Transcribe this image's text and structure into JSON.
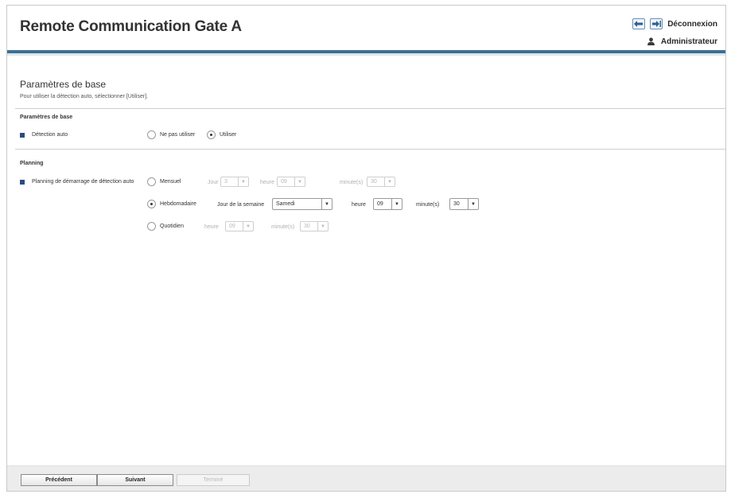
{
  "header": {
    "app_title": "Remote Communication Gate A",
    "logout_label": "Déconnexion",
    "user_label": "Administrateur",
    "icons": [
      "back-icon",
      "logout-icon",
      "user-icon"
    ],
    "accent_color": "#3c6f93"
  },
  "page": {
    "title": "Paramètres de base",
    "description": "Pour utiliser la détection auto, sélectionner [Utiliser]."
  },
  "basic": {
    "section_title": "Paramètres de base",
    "label": "Détection auto",
    "options": [
      {
        "label": "Ne pas utiliser",
        "selected": false
      },
      {
        "label": "Utiliser",
        "selected": true
      }
    ]
  },
  "planning": {
    "section_title": "Planning",
    "label": "Planning de démarrage de détection auto",
    "manual": {
      "label": "Mensuel",
      "selected": false,
      "day_label": "Jour",
      "day_value": "3",
      "hour_label": "heure",
      "hour_value": "09",
      "minute_label": "minute(s)",
      "minute_value": "30"
    },
    "weekly": {
      "label": "Hebdomadaire",
      "selected": true,
      "weekday_label": "Jour de la semaine",
      "weekday_value": "Samedi",
      "hour_label": "heure",
      "hour_value": "09",
      "minute_label": "minute(s)",
      "minute_value": "30"
    },
    "daily": {
      "label": "Quotidien",
      "selected": false,
      "hour_label": "heure",
      "hour_value": "09",
      "minute_label": "minute(s)",
      "minute_value": "30"
    }
  },
  "footer": {
    "prev_label": "Précédent",
    "next_label": "Suivant",
    "finish_label": "Terminé"
  }
}
